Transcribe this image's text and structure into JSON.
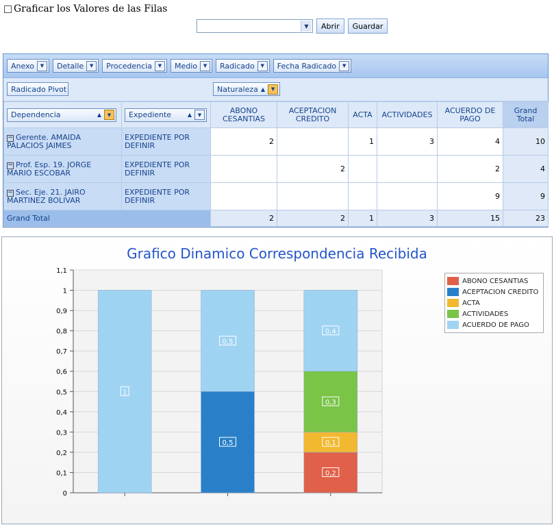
{
  "top": {
    "checkbox_label": "Graficar los Valores de las Filas"
  },
  "toolbar": {
    "combo_value": "",
    "open_label": "Abrir",
    "save_label": "Guardar"
  },
  "pivot": {
    "filter_fields": [
      "Anexo",
      "Detalle",
      "Procedencia",
      "Medio",
      "Radicado",
      "Fecha Radicado"
    ],
    "data_field": "Radicado Pivot",
    "column_field": "Naturaleza",
    "row_fields": [
      "Dependencia",
      "Expediente"
    ],
    "columns": [
      "ABONO CESANTIAS",
      "ACEPTACION CREDITO",
      "ACTA",
      "ACTIVIDADES",
      "ACUERDO DE PAGO",
      "Grand Total"
    ],
    "rows": [
      {
        "dependencia": "Gerente. AMAIDA PALACIOS JAIMES",
        "expediente": "EXPEDIENTE POR DEFINIR",
        "values": [
          "2",
          "",
          "1",
          "3",
          "4",
          "10"
        ]
      },
      {
        "dependencia": "Prof. Esp. 19. JORGE MARIO ESCOBAR",
        "expediente": "EXPEDIENTE POR DEFINIR",
        "values": [
          "",
          "2",
          "",
          "",
          "2",
          "4"
        ]
      },
      {
        "dependencia": "Sec. Eje. 21. JAIRO MARTINEZ BOLIVAR",
        "expediente": "EXPEDIENTE POR DEFINIR",
        "values": [
          "",
          "",
          "",
          "",
          "9",
          "9"
        ]
      }
    ],
    "grand_total": {
      "label": "Grand Total",
      "values": [
        "2",
        "2",
        "1",
        "3",
        "15",
        "23"
      ]
    }
  },
  "chart_data": {
    "type": "bar",
    "stacked": true,
    "title": "Grafico Dinamico Correspondencia Recibida",
    "xlabel": "",
    "ylabel": "",
    "ylim": [
      0,
      1.1
    ],
    "yticks": [
      "0",
      "0,1",
      "0,2",
      "0,3",
      "0,4",
      "0,5",
      "0,6",
      "0,7",
      "0,8",
      "0,9",
      "1",
      "1,1"
    ],
    "categories": [
      "",
      "",
      ""
    ],
    "legend_position": "top-right",
    "series": [
      {
        "name": "ABONO CESANTIAS",
        "color": "#e0604a",
        "values": [
          0,
          0,
          0.2
        ]
      },
      {
        "name": "ACEPTACION CREDITO",
        "color": "#2a80c8",
        "values": [
          0,
          0.5,
          0
        ]
      },
      {
        "name": "ACTA",
        "color": "#f2b830",
        "values": [
          0,
          0,
          0.1
        ]
      },
      {
        "name": "ACTIVIDADES",
        "color": "#7ac448",
        "values": [
          0,
          0,
          0.3
        ]
      },
      {
        "name": "ACUERDO DE PAGO",
        "color": "#9fd3f2",
        "values": [
          1,
          0.5,
          0.4
        ]
      }
    ],
    "data_labels": [
      [
        "1"
      ],
      [
        "0,5",
        "0,5"
      ],
      [
        "0,2",
        "0,1",
        "0,3",
        "0,4"
      ]
    ]
  }
}
